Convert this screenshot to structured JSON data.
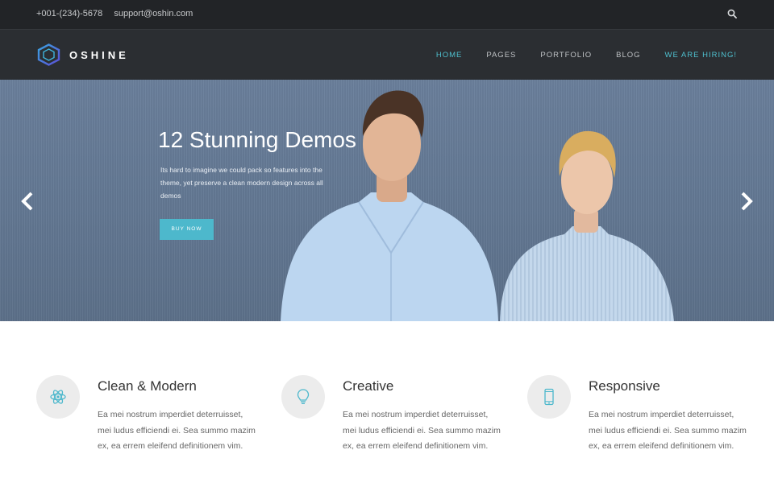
{
  "topbar": {
    "phone": "+001-(234)-5678",
    "email": "support@oshin.com",
    "search_icon": "search-icon"
  },
  "header": {
    "logo_text": "OSHINE",
    "nav": [
      {
        "label": "HOME"
      },
      {
        "label": "PAGES"
      },
      {
        "label": "PORTFOLIO"
      },
      {
        "label": "BLOG"
      },
      {
        "label": "WE ARE HIRING!"
      }
    ]
  },
  "hero": {
    "title": "12 Stunning Demos",
    "description": "Its hard to imagine we could pack so features into the theme, yet preserve a clean modern design across all demos",
    "button_label": "BUY NOW"
  },
  "features": [
    {
      "icon": "atom-icon",
      "title": "Clean & Modern",
      "text": "Ea mei nostrum imperdiet deterruisset, mei ludus efficiendi ei. Sea summo mazim ex, ea errem eleifend definitionem vim."
    },
    {
      "icon": "lightbulb-icon",
      "title": "Creative",
      "text": "Ea mei nostrum imperdiet deterruisset, mei ludus efficiendi ei. Sea summo mazim ex, ea errem eleifend definitionem vim."
    },
    {
      "icon": "mobile-icon",
      "title": "Responsive",
      "text": "Ea mei nostrum imperdiet deterruisset, mei ludus efficiendi ei. Sea summo mazim ex, ea errem eleifend definitionem vim."
    }
  ],
  "colors": {
    "accent": "#4fc0cf",
    "topbar_bg": "#222427",
    "header_bg": "#2b2e32",
    "hero_bg": "#637893"
  }
}
